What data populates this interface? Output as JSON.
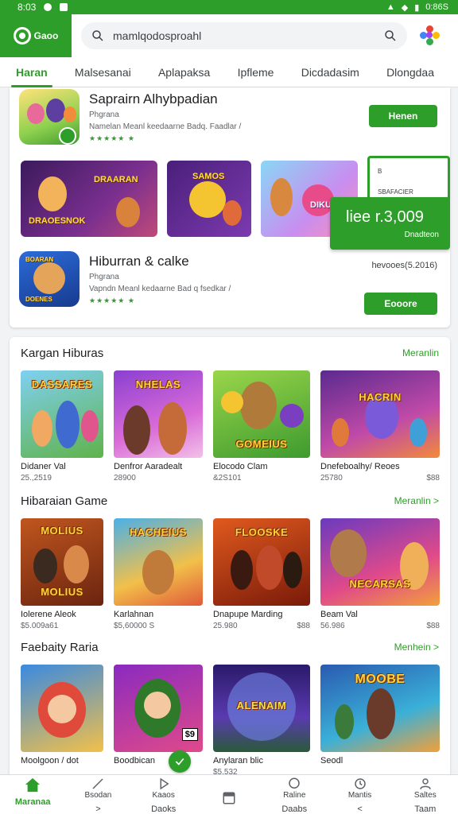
{
  "status_bar": {
    "time": "8:03",
    "battery": "0:86S"
  },
  "header": {
    "logo_text": "Gaoo",
    "search_value": "",
    "search_placeholder": "mamlqodosproahl"
  },
  "tabs": [
    {
      "label": "Haran",
      "active": true
    },
    {
      "label": "Malsesanai"
    },
    {
      "label": "Aplapaksa"
    },
    {
      "label": "Ipfleme"
    },
    {
      "label": "Dicdadasim"
    },
    {
      "label": "Dlongdaa"
    }
  ],
  "featured": {
    "app1": {
      "title": "Saprairn Alhybpadian",
      "developer": "Phgrana",
      "desc": "Namelan Meanl keedaarne Badq. Faadlar /",
      "stars": "★★★★★ ★",
      "button": "Henen"
    },
    "banners": [
      {
        "text_top": "DRAARAN",
        "text_bottom": "DRAOESNOK"
      },
      {
        "text_top": "SAMOS"
      },
      {
        "text_top": "DIKU"
      }
    ],
    "promo_card": {
      "line1": "B",
      "line2": "SBAFACIER"
    },
    "promo_green": {
      "price": "liee r.3,009",
      "sub": "Dnadteon"
    },
    "app2": {
      "title": "Hiburran & calke",
      "developer": "Phgrana",
      "desc": "Vapndn Meanl kedaarne Bad q fsedkar /",
      "stars": "★★★★★ ★",
      "button": "Eooore",
      "price_note": "hevooes(5.2016)"
    }
  },
  "sections": [
    {
      "title": "Kargan Hiburas",
      "more": "Meranlin",
      "games": [
        {
          "label": "DASSARES",
          "name": "Didaner Val",
          "meta": "25.,2519",
          "price": ""
        },
        {
          "label": "NHELAS",
          "name": "Denfror Aaradealt",
          "meta": "28900",
          "price": ""
        },
        {
          "label": "GOMEIUS",
          "name": "Elocodo Clam",
          "meta": "&2S101",
          "price": ""
        },
        {
          "label": "HACRIN",
          "name": "Dnefeboalhy/ Reoes",
          "meta": "25780",
          "price": "$88"
        }
      ]
    },
    {
      "title": "Hibaraian Game",
      "more": "Meranlin >",
      "games": [
        {
          "label": "MOLIUS",
          "name": "Iolerene Aleok",
          "meta": "$5.009a61",
          "price": ""
        },
        {
          "label": "HACHEIUS",
          "name": "Karlahnan",
          "meta": "$5,60000 S",
          "price": ""
        },
        {
          "label": "FLOOSKE",
          "name": "Dnapupe Marding",
          "meta": "25.980",
          "price": "$88"
        },
        {
          "label": "NECARSAS",
          "name": "Beam Val",
          "meta": "56.986",
          "price": "$88"
        }
      ]
    },
    {
      "title": "Faebaity Raria",
      "more": "Menhein >",
      "games": [
        {
          "label": "",
          "name": "Moolgoon / dot",
          "meta": "",
          "price": ""
        },
        {
          "label": "",
          "name": "Boodbican",
          "meta": "",
          "price": ""
        },
        {
          "label": "ALENAIM",
          "name": "Anylaran blic",
          "meta": "$5.532",
          "price": ""
        },
        {
          "label": "MOOBE",
          "name": "Seodl",
          "meta": "",
          "price": ""
        }
      ]
    }
  ],
  "bottom_nav": [
    {
      "label": "",
      "sub": "Maranaa",
      "icon": "home-icon",
      "active": true
    },
    {
      "label": "Bsodan",
      "sub": ">",
      "icon": "brush-icon"
    },
    {
      "label": "Kaaos",
      "sub": "Daoks",
      "icon": "play-icon"
    },
    {
      "label": "",
      "sub": "",
      "icon": "square-icon"
    },
    {
      "label": "Raline",
      "sub": "Daabs",
      "icon": "chat-icon"
    },
    {
      "label": "Mantis",
      "sub": "<",
      "icon": "clock-icon"
    },
    {
      "label": "Saltes",
      "sub": "Taam",
      "icon": "person-icon"
    }
  ],
  "colors": {
    "accent": "#2e9e2a",
    "surface": "#ffffff",
    "background": "#f1f3f4"
  }
}
